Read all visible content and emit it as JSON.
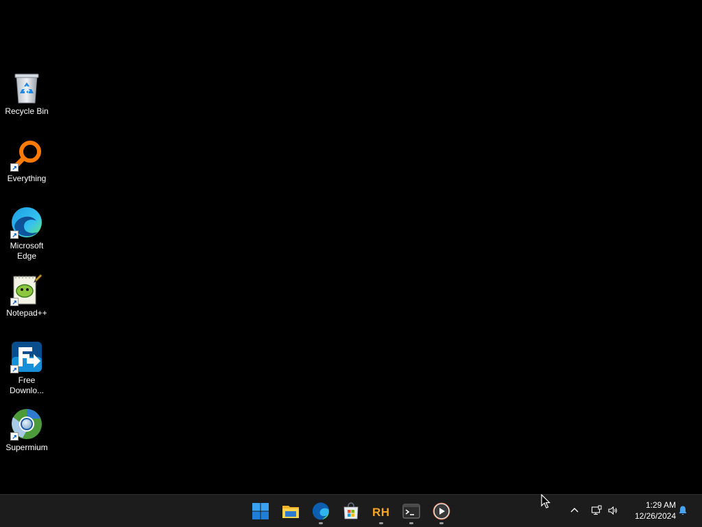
{
  "desktop": {
    "background_color": "#000000",
    "icons": [
      {
        "label": "Recycle Bin",
        "icon": "recycle-bin-icon",
        "shortcut": false
      },
      {
        "label": "Everything",
        "icon": "everything-search-icon",
        "shortcut": true
      },
      {
        "label": "Microsoft Edge",
        "icon": "edge-icon",
        "shortcut": true
      },
      {
        "label": "Notepad++",
        "icon": "notepad-plus-plus-icon",
        "shortcut": true
      },
      {
        "label": "Free Downlo...",
        "icon": "free-download-manager-icon",
        "shortcut": true
      },
      {
        "label": "Supermium",
        "icon": "supermium-icon",
        "shortcut": true
      }
    ]
  },
  "taskbar": {
    "background_color": "#1c1c1c",
    "apps": [
      {
        "icon": "windows-start-icon",
        "running": false
      },
      {
        "icon": "file-explorer-icon",
        "running": false
      },
      {
        "icon": "edge-icon",
        "running": true
      },
      {
        "icon": "microsoft-store-icon",
        "running": false
      },
      {
        "icon": "resource-hacker-icon",
        "running": true
      },
      {
        "icon": "terminal-icon",
        "running": true
      },
      {
        "icon": "media-player-icon",
        "running": true
      }
    ],
    "tray": {
      "icons": [
        "chevron-up-icon",
        "network-icon",
        "volume-icon",
        "notification-bell-icon"
      ],
      "time": "1:29 AM",
      "date": "12/26/2024"
    }
  },
  "accent_color": "#0078d4"
}
